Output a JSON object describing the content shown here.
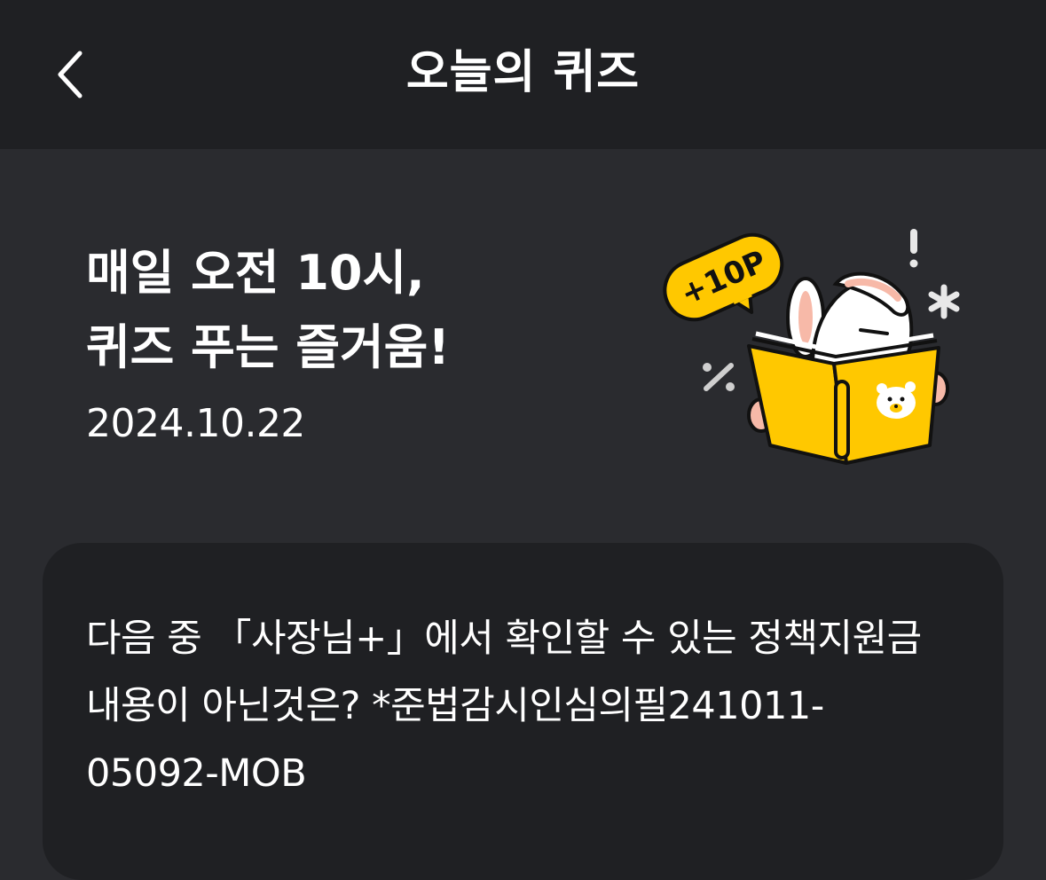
{
  "header": {
    "title": "오늘의 퀴즈",
    "back_icon": "chevron-left-icon"
  },
  "hero": {
    "title_line1": "매일 오전 10시,",
    "title_line2": "퀴즈 푸는 즐거움!",
    "date": "2024.10.22",
    "badge_text": "+10P",
    "illustration": "rabbit-reading-book-illustration"
  },
  "quiz": {
    "question": "다음 중 「사장님+」에서 확인할 수 있는 정책지원금 내용이 아닌것은? *준법감시인심의필241011-05092-MOB"
  },
  "colors": {
    "header_bg": "#1f2023",
    "page_bg": "#2a2b2f",
    "card_bg": "#1f2023",
    "accent_yellow": "#ffc800",
    "text": "#ffffff"
  }
}
